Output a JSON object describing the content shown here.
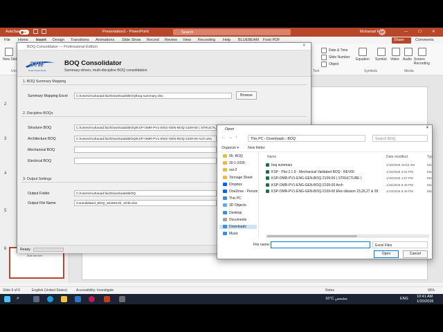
{
  "powerpoint": {
    "autosave_label": "AutoSave",
    "autosave_state": "Off",
    "window_title": "Presentation1 - PowerPoint",
    "search_placeholder": "Search",
    "user_name": "Muhanad Faiz",
    "user_initials": "MF",
    "menu": [
      "File",
      "Home",
      "Insert",
      "Design",
      "Transitions",
      "Animations",
      "Slide Show",
      "Record",
      "Review",
      "View",
      "Recording",
      "Help",
      "BLUEBEAM",
      "Foxit PDF"
    ],
    "share_label": "Share",
    "comments_label": "Comments",
    "ribbon": {
      "new_slide": "New Slide",
      "undo_group": "Undo",
      "date_time": "Date & Time",
      "slide_number": "Slide Number",
      "object": "Object",
      "text_group": "Text",
      "equation": "Equation",
      "symbol": "Symbol",
      "symbols_group": "Symbols",
      "video": "Video",
      "audio": "Audio",
      "screen_recording": "Screen Recording",
      "media_group": "Media"
    },
    "slide_numbers": [
      "2",
      "3",
      "4",
      "5",
      "6"
    ],
    "thumb_text": "Slide text here",
    "status": {
      "slide": "Slide 6 of 6",
      "language": "English (United States)",
      "accessibility": "Accessibility: Investigate",
      "notes": "Notes",
      "zoom": "99%"
    }
  },
  "boq": {
    "window_title": "BOQ Consolidator — Professional Edition",
    "logo_text": "STW",
    "logo_sub": "Smart Trade Works",
    "app_title": "BOQ Consolidator",
    "app_subtitle": "Summary-driven, multi-discipline BOQ consolidation",
    "section1": "1. BOQ Summary Mapping",
    "summary_label": "Summary Mapping Excel",
    "summary_path": "C:/Users/muhanad.faiz/Downloads/BOQ/boq summary.xlsx",
    "browse_label": "Browse",
    "section2": "2. Discipline BOQs",
    "structure_label": "Structure BOQ",
    "structure_path": "C:/Users/muhanad.faiz/Downloads/BOQ/KSP-OMR-PV1-ENG-GEN-BOQ-2109-00 ( STRUCTURE ).xlsx",
    "architecture_label": "Architecture BOQ",
    "architecture_path": "C:/Users/muhanad.faiz/Downloads/BOQ/KSP-OMR-PV1-ENG-GEN-BOQ-2109-00 Arch.xlsx",
    "mechanical_label": "Mechanical BOQ",
    "mechanical_path": "",
    "electrical_label": "Electrical BOQ",
    "electrical_path": "",
    "section3": "3. Output Settings",
    "output_folder_label": "Output Folder",
    "output_folder": "C:/Users/muhanad.faiz/Downloads/BOQ",
    "output_file_label": "Output File Name",
    "output_file": "Consolidated_BOQ_20260120_1035.xlsx",
    "status": "Ready",
    "progress": 0
  },
  "open_dialog": {
    "title": "Open",
    "breadcrumb": "This PC  ›  Downloads  ›  BOQ",
    "search_placeholder": "Search BOQ",
    "organize": "Organize ▾",
    "new_folder": "New folder",
    "nav": [
      {
        "label": "05- BOQ",
        "color": "#e8b84a"
      },
      {
        "label": "20-1-2026",
        "color": "#e8b84a"
      },
      {
        "label": "out-2",
        "color": "#e8b84a"
      },
      {
        "label": "Tonnage Sheet",
        "color": "#e8b84a"
      },
      {
        "label": "Dropbox",
        "color": "#0061fe"
      },
      {
        "label": "OneDrive - Person",
        "color": "#0a64d8"
      },
      {
        "label": "This PC",
        "color": "#3c8fd6"
      },
      {
        "label": "3D Objects",
        "color": "#6aa8e0"
      },
      {
        "label": "Desktop",
        "color": "#3c8fd6"
      },
      {
        "label": "Documents",
        "color": "#9aa5b1"
      },
      {
        "label": "Downloads",
        "color": "#3c8fd6"
      },
      {
        "label": "Music",
        "color": "#3c8fd6"
      }
    ],
    "col_name": "Name",
    "col_date": "Date modified",
    "col_type": "Typ",
    "files": [
      {
        "name": "boq summary",
        "date": "1/18/2026 10:53 AM",
        "type": "Mic"
      },
      {
        "name": "KSP - Plot 2.1.9 - Mechanical Validated BOQ - REV00",
        "date": "1/15/2026 4:01 PM",
        "type": "Mic"
      },
      {
        "name": "KSP-OMR-PV1-ENG-GEN-BOQ-2109-00 ( STRUCTURE )",
        "date": "1/15/2026 1:57 PM",
        "type": "Mic"
      },
      {
        "name": "KSP-OMR-PV1-ENG-GEN-BOQ-2109-00 Arch",
        "date": "1/15/2026 5:46 PM",
        "type": "Mic"
      },
      {
        "name": "KSP-OMR-PV1-ENG-GEN-BOQ-2109-00 Elec-division 23,26,27 & 28",
        "date": "1/14/2026 5:45 PM",
        "type": "Mic"
      }
    ],
    "file_name_label": "File name:",
    "file_name_value": "",
    "file_type": "Excel Files",
    "open_label": "Open",
    "cancel_label": "Cancel"
  },
  "taskbar": {
    "search": "Search",
    "weather": "16°C  مشمس",
    "lang": "ENG",
    "time": "10:41 AM",
    "date": "1/20/2026"
  }
}
